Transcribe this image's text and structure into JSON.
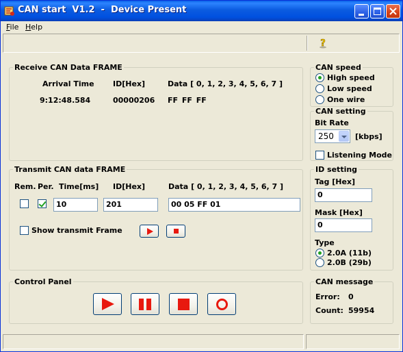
{
  "window": {
    "title": "CAN start  V1.2  -  Device Present",
    "icons": [
      "can-app-icon",
      "minimize-icon",
      "maximize-icon",
      "close-icon"
    ]
  },
  "menu": {
    "file": "File",
    "help": "Help"
  },
  "toolbar": {
    "help_icon": "question-mark-icon"
  },
  "receive": {
    "title": "Receive CAN Data FRAME",
    "col_time": "Arrival Time",
    "col_id": "ID[Hex]",
    "col_data": "Data [ 0,  1,  2,  3,  4,  5,  6,  7 ]",
    "row": {
      "time": "9:12:48.584",
      "id": "00000206",
      "data": "FF  FF  FF"
    }
  },
  "transmit": {
    "title": "Transmit CAN data FRAME",
    "col_rem": "Rem.",
    "col_per": "Per.",
    "col_time": "Time[ms]",
    "col_id": "ID[Hex]",
    "col_data": "Data [ 0,  1,  2,  3,  4,  5,  6,  7 ]",
    "rem_checked": false,
    "per_checked": true,
    "time_value": "10",
    "id_value": "201",
    "data_value": "00 05 FF 01",
    "show_transmit_label": "Show transmit Frame",
    "show_transmit_checked": false
  },
  "control_panel": {
    "title": "Control Panel",
    "buttons": [
      "play-icon",
      "pause-icon",
      "stop-icon",
      "record-icon"
    ]
  },
  "can_speed": {
    "title": "CAN speed",
    "options": [
      "High speed",
      "Low speed",
      "One wire"
    ],
    "selected": "High speed"
  },
  "can_setting": {
    "title": "CAN setting",
    "bit_rate_label": "Bit Rate",
    "bit_rate_value": "250",
    "bit_rate_unit": "[kbps]",
    "listening_label": "Listening Mode",
    "listening_checked": false
  },
  "id_setting": {
    "title": "ID setting",
    "tag_label": "Tag [Hex]",
    "tag_value": "0",
    "mask_label": "Mask [Hex]",
    "mask_value": "0",
    "type_label": "Type",
    "type_options": [
      "2.0A (11b)",
      "2.0B (29b)"
    ],
    "type_selected": "2.0A (11b)"
  },
  "can_message": {
    "title": "CAN message",
    "error_label": "Error:",
    "error_value": "0",
    "count_label": "Count:",
    "count_value": "59954"
  },
  "colors": {
    "titlebar": "#0a5ce0",
    "accent_red": "#e8190f",
    "window_bg": "#ece9d8",
    "check_green": "#21a121"
  }
}
